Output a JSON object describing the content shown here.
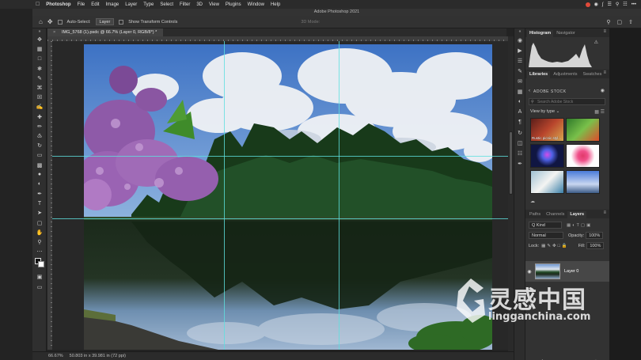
{
  "menubar": {
    "app_name": "Photoshop",
    "menus": [
      "File",
      "Edit",
      "Image",
      "Layer",
      "Type",
      "Select",
      "Filter",
      "3D",
      "View",
      "Plugins",
      "Window",
      "Help"
    ],
    "clock": "•••"
  },
  "titlebar": {
    "title": "Adobe Photoshop 2021"
  },
  "options": {
    "auto_select_label": "Auto-Select:",
    "auto_select_value": "Layer",
    "transform_label": "Show Transform Controls",
    "mode_3d_label": "3D Mode:"
  },
  "document": {
    "tab_title": "IMG_5768 (1).psdc @ 66.7% (Layer 0, RGB/8*) *"
  },
  "status": {
    "zoom": "66.67%",
    "info": "50.803 in x 39.981 in (72 ppi)"
  },
  "panels": {
    "top_tabs": [
      "Histogram",
      "Navigator"
    ],
    "mid_tabs": [
      "Libraries",
      "Adjustments",
      "Swatches"
    ],
    "adobe_stock": "ADOBE STOCK",
    "search_placeholder": "Search Adobe Stock",
    "view_by": "View by type",
    "thumb_caption": "Rustic picnic styl...",
    "layer_tabs": [
      "Paths",
      "Channels",
      "Layers"
    ],
    "kind": "Q Kind",
    "blend_mode": "Normal",
    "opacity_label": "Opacity:",
    "opacity_value": "100%",
    "lock_label": "Lock:",
    "fill_label": "Fill:",
    "fill_value": "100%",
    "layer_name": "Layer 0"
  },
  "colors": {
    "accent_guide": "#5ee0df",
    "panel_bg": "#323232",
    "app_bg": "#232323"
  }
}
